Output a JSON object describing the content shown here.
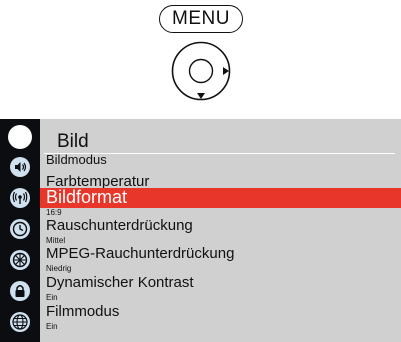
{
  "remote": {
    "menu_key": "MENU",
    "nav_pad_icon": "navigation-ring-right-down-arrows"
  },
  "sidebar": {
    "icons": [
      "picture-circle-icon",
      "speaker-icon",
      "antenna-icon",
      "clock-icon",
      "settings-wheel-icon",
      "lock-icon",
      "globe-icon"
    ],
    "selected_index": 0
  },
  "menu": {
    "title": "Bild",
    "items": [
      {
        "label": "Bildmodus"
      },
      {
        "label": "Farbtemperatur"
      },
      {
        "label": "Bildformat",
        "value": "16:9",
        "selected": true
      },
      {
        "label": "Rauschunterdrückung",
        "value": "Mittel"
      },
      {
        "label": "MPEG-Rauchunterdrückung",
        "value": "Niedrig"
      },
      {
        "label": "Dynamischer Kontrast",
        "value": "Ein"
      },
      {
        "label": "Filmmodus",
        "value": "Ein"
      }
    ]
  },
  "colors": {
    "highlight": "#e8372a",
    "sidebar_bg": "#0c0d10",
    "panel_bg": "#d0d0d0"
  }
}
